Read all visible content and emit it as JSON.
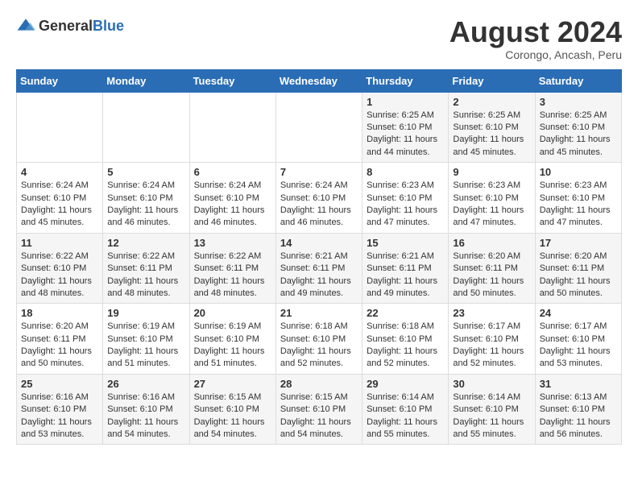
{
  "logo": {
    "general": "General",
    "blue": "Blue"
  },
  "title": "August 2024",
  "subtitle": "Corongo, Ancash, Peru",
  "days_of_week": [
    "Sunday",
    "Monday",
    "Tuesday",
    "Wednesday",
    "Thursday",
    "Friday",
    "Saturday"
  ],
  "weeks": [
    [
      {
        "day": "",
        "info": ""
      },
      {
        "day": "",
        "info": ""
      },
      {
        "day": "",
        "info": ""
      },
      {
        "day": "",
        "info": ""
      },
      {
        "day": "1",
        "info": "Sunrise: 6:25 AM\nSunset: 6:10 PM\nDaylight: 11 hours\nand 44 minutes."
      },
      {
        "day": "2",
        "info": "Sunrise: 6:25 AM\nSunset: 6:10 PM\nDaylight: 11 hours\nand 45 minutes."
      },
      {
        "day": "3",
        "info": "Sunrise: 6:25 AM\nSunset: 6:10 PM\nDaylight: 11 hours\nand 45 minutes."
      }
    ],
    [
      {
        "day": "4",
        "info": "Sunrise: 6:24 AM\nSunset: 6:10 PM\nDaylight: 11 hours\nand 45 minutes."
      },
      {
        "day": "5",
        "info": "Sunrise: 6:24 AM\nSunset: 6:10 PM\nDaylight: 11 hours\nand 46 minutes."
      },
      {
        "day": "6",
        "info": "Sunrise: 6:24 AM\nSunset: 6:10 PM\nDaylight: 11 hours\nand 46 minutes."
      },
      {
        "day": "7",
        "info": "Sunrise: 6:24 AM\nSunset: 6:10 PM\nDaylight: 11 hours\nand 46 minutes."
      },
      {
        "day": "8",
        "info": "Sunrise: 6:23 AM\nSunset: 6:10 PM\nDaylight: 11 hours\nand 47 minutes."
      },
      {
        "day": "9",
        "info": "Sunrise: 6:23 AM\nSunset: 6:10 PM\nDaylight: 11 hours\nand 47 minutes."
      },
      {
        "day": "10",
        "info": "Sunrise: 6:23 AM\nSunset: 6:10 PM\nDaylight: 11 hours\nand 47 minutes."
      }
    ],
    [
      {
        "day": "11",
        "info": "Sunrise: 6:22 AM\nSunset: 6:10 PM\nDaylight: 11 hours\nand 48 minutes."
      },
      {
        "day": "12",
        "info": "Sunrise: 6:22 AM\nSunset: 6:11 PM\nDaylight: 11 hours\nand 48 minutes."
      },
      {
        "day": "13",
        "info": "Sunrise: 6:22 AM\nSunset: 6:11 PM\nDaylight: 11 hours\nand 48 minutes."
      },
      {
        "day": "14",
        "info": "Sunrise: 6:21 AM\nSunset: 6:11 PM\nDaylight: 11 hours\nand 49 minutes."
      },
      {
        "day": "15",
        "info": "Sunrise: 6:21 AM\nSunset: 6:11 PM\nDaylight: 11 hours\nand 49 minutes."
      },
      {
        "day": "16",
        "info": "Sunrise: 6:20 AM\nSunset: 6:11 PM\nDaylight: 11 hours\nand 50 minutes."
      },
      {
        "day": "17",
        "info": "Sunrise: 6:20 AM\nSunset: 6:11 PM\nDaylight: 11 hours\nand 50 minutes."
      }
    ],
    [
      {
        "day": "18",
        "info": "Sunrise: 6:20 AM\nSunset: 6:11 PM\nDaylight: 11 hours\nand 50 minutes."
      },
      {
        "day": "19",
        "info": "Sunrise: 6:19 AM\nSunset: 6:10 PM\nDaylight: 11 hours\nand 51 minutes."
      },
      {
        "day": "20",
        "info": "Sunrise: 6:19 AM\nSunset: 6:10 PM\nDaylight: 11 hours\nand 51 minutes."
      },
      {
        "day": "21",
        "info": "Sunrise: 6:18 AM\nSunset: 6:10 PM\nDaylight: 11 hours\nand 52 minutes."
      },
      {
        "day": "22",
        "info": "Sunrise: 6:18 AM\nSunset: 6:10 PM\nDaylight: 11 hours\nand 52 minutes."
      },
      {
        "day": "23",
        "info": "Sunrise: 6:17 AM\nSunset: 6:10 PM\nDaylight: 11 hours\nand 52 minutes."
      },
      {
        "day": "24",
        "info": "Sunrise: 6:17 AM\nSunset: 6:10 PM\nDaylight: 11 hours\nand 53 minutes."
      }
    ],
    [
      {
        "day": "25",
        "info": "Sunrise: 6:16 AM\nSunset: 6:10 PM\nDaylight: 11 hours\nand 53 minutes."
      },
      {
        "day": "26",
        "info": "Sunrise: 6:16 AM\nSunset: 6:10 PM\nDaylight: 11 hours\nand 54 minutes."
      },
      {
        "day": "27",
        "info": "Sunrise: 6:15 AM\nSunset: 6:10 PM\nDaylight: 11 hours\nand 54 minutes."
      },
      {
        "day": "28",
        "info": "Sunrise: 6:15 AM\nSunset: 6:10 PM\nDaylight: 11 hours\nand 54 minutes."
      },
      {
        "day": "29",
        "info": "Sunrise: 6:14 AM\nSunset: 6:10 PM\nDaylight: 11 hours\nand 55 minutes."
      },
      {
        "day": "30",
        "info": "Sunrise: 6:14 AM\nSunset: 6:10 PM\nDaylight: 11 hours\nand 55 minutes."
      },
      {
        "day": "31",
        "info": "Sunrise: 6:13 AM\nSunset: 6:10 PM\nDaylight: 11 hours\nand 56 minutes."
      }
    ]
  ]
}
